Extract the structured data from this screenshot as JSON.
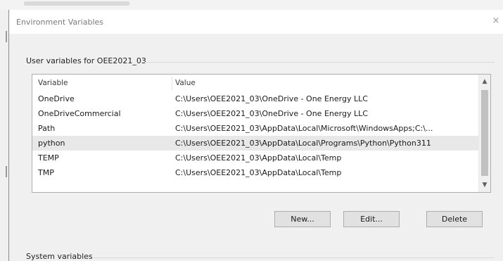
{
  "window": {
    "title": "Environment Variables",
    "close_glyph": "×"
  },
  "user_vars": {
    "group_label": "User variables for OEE2021_03",
    "columns": [
      "Variable",
      "Value"
    ],
    "rows": [
      {
        "variable": "OneDrive",
        "value": "C:\\Users\\OEE2021_03\\OneDrive - One Energy LLC"
      },
      {
        "variable": "OneDriveCommercial",
        "value": "C:\\Users\\OEE2021_03\\OneDrive - One Energy LLC"
      },
      {
        "variable": "Path",
        "value": "C:\\Users\\OEE2021_03\\AppData\\Local\\Microsoft\\WindowsApps;C:\\..."
      },
      {
        "variable": "python",
        "value": "C:\\Users\\OEE2021_03\\AppData\\Local\\Programs\\Python\\Python311"
      },
      {
        "variable": "TEMP",
        "value": "C:\\Users\\OEE2021_03\\AppData\\Local\\Temp"
      },
      {
        "variable": "TMP",
        "value": "C:\\Users\\OEE2021_03\\AppData\\Local\\Temp"
      }
    ],
    "selected_row": "python",
    "buttons": {
      "new_label": "New...",
      "edit_label": "Edit...",
      "delete_label": "Delete"
    }
  },
  "system_vars": {
    "group_label": "System variables"
  },
  "icons": {
    "close": "close-icon",
    "scroll_up": "chevron-up-icon",
    "scroll_down": "chevron-down-icon"
  },
  "colors": {
    "selected_row": "#e8e8e8",
    "button_face": "#e1e1e1",
    "dialog_body": "#f0f0f0"
  }
}
